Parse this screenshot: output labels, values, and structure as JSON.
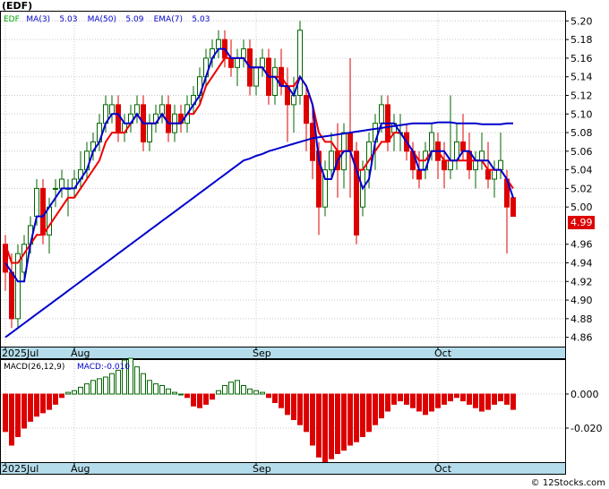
{
  "price_panel": {
    "symbol": "(EDF)",
    "legend": [
      {
        "label": "EDF",
        "color": "#00aa00"
      },
      {
        "label": "MA(3)",
        "color": "#0000cc"
      },
      {
        "label": "5.03",
        "color": "#0000cc"
      },
      {
        "label": "MA(50)",
        "color": "#0000cc"
      },
      {
        "label": "5.09",
        "color": "#0000cc"
      },
      {
        "label": "EMA(7)",
        "color": "#0000cc"
      },
      {
        "label": "5.03",
        "color": "#0000cc"
      }
    ],
    "last_price_label": "4.99"
  },
  "macd_panel": {
    "label": "MACD(26,12,9)",
    "value_label": "MACD:-0.010"
  },
  "watermark": "© 12Stocks.com",
  "colors": {
    "up": "#006600",
    "down": "#dd0000",
    "ma": "#0000cc",
    "ema": "#ee0000",
    "axis_band": "#b4dcea"
  },
  "chart_data": [
    {
      "type": "candlestick",
      "ylim": [
        4.85,
        5.21
      ],
      "yticks": [
        4.86,
        4.88,
        4.9,
        4.92,
        4.94,
        4.96,
        5.0,
        5.02,
        5.04,
        5.06,
        5.08,
        5.1,
        5.12,
        5.14,
        5.16,
        5.18,
        5.2
      ],
      "xtick_labels": [
        {
          "label": "2025Jul",
          "index": 0
        },
        {
          "label": "Aug",
          "index": 11
        },
        {
          "label": "Sep",
          "index": 40
        },
        {
          "label": "Oct",
          "index": 69
        }
      ],
      "candles": [
        [
          4.96,
          4.97,
          4.91,
          4.93
        ],
        [
          4.93,
          4.95,
          4.87,
          4.88
        ],
        [
          4.88,
          4.96,
          4.87,
          4.95
        ],
        [
          4.93,
          4.97,
          4.92,
          4.96
        ],
        [
          4.96,
          4.99,
          4.95,
          4.98
        ],
        [
          4.99,
          5.03,
          4.98,
          5.02
        ],
        [
          5.02,
          5.03,
          4.96,
          4.97
        ],
        [
          4.97,
          5.01,
          4.95,
          5.0
        ],
        [
          5.02,
          5.03,
          5.0,
          5.02
        ],
        [
          5.02,
          5.04,
          5.01,
          5.03
        ],
        [
          5.02,
          5.03,
          4.99,
          5.02
        ],
        [
          5.02,
          5.04,
          5.01,
          5.03
        ],
        [
          5.03,
          5.06,
          5.02,
          5.04
        ],
        [
          5.04,
          5.07,
          5.03,
          5.06
        ],
        [
          5.06,
          5.08,
          5.05,
          5.07
        ],
        [
          5.07,
          5.1,
          5.06,
          5.09
        ],
        [
          5.09,
          5.12,
          5.08,
          5.11
        ],
        [
          5.1,
          5.12,
          5.09,
          5.11
        ],
        [
          5.11,
          5.12,
          5.07,
          5.08
        ],
        [
          5.08,
          5.1,
          5.07,
          5.09
        ],
        [
          5.09,
          5.11,
          5.08,
          5.1
        ],
        [
          5.1,
          5.12,
          5.09,
          5.11
        ],
        [
          5.11,
          5.12,
          5.06,
          5.07
        ],
        [
          5.07,
          5.1,
          5.06,
          5.09
        ],
        [
          5.09,
          5.11,
          5.08,
          5.1
        ],
        [
          5.1,
          5.12,
          5.09,
          5.11
        ],
        [
          5.11,
          5.12,
          5.07,
          5.08
        ],
        [
          5.08,
          5.11,
          5.07,
          5.1
        ],
        [
          5.1,
          5.11,
          5.08,
          5.09
        ],
        [
          5.09,
          5.12,
          5.08,
          5.11
        ],
        [
          5.11,
          5.13,
          5.1,
          5.12
        ],
        [
          5.12,
          5.15,
          5.11,
          5.14
        ],
        [
          5.14,
          5.17,
          5.13,
          5.16
        ],
        [
          5.16,
          5.18,
          5.15,
          5.17
        ],
        [
          5.17,
          5.19,
          5.16,
          5.18
        ],
        [
          5.18,
          5.19,
          5.15,
          5.16
        ],
        [
          5.16,
          5.18,
          5.14,
          5.15
        ],
        [
          5.15,
          5.17,
          5.13,
          5.16
        ],
        [
          5.16,
          5.18,
          5.15,
          5.17
        ],
        [
          5.17,
          5.18,
          5.12,
          5.13
        ],
        [
          5.13,
          5.16,
          5.12,
          5.15
        ],
        [
          5.15,
          5.17,
          5.14,
          5.16
        ],
        [
          5.16,
          5.17,
          5.11,
          5.12
        ],
        [
          5.12,
          5.16,
          5.11,
          5.15
        ],
        [
          5.15,
          5.17,
          5.12,
          5.13
        ],
        [
          5.13,
          5.15,
          5.07,
          5.11
        ],
        [
          5.11,
          5.14,
          5.08,
          5.12
        ],
        [
          5.12,
          5.2,
          5.11,
          5.19
        ],
        [
          5.12,
          5.13,
          5.06,
          5.09
        ],
        [
          5.09,
          5.11,
          5.03,
          5.05
        ],
        [
          5.06,
          5.07,
          4.97,
          5.0
        ],
        [
          5.0,
          5.05,
          4.99,
          5.04
        ],
        [
          5.04,
          5.08,
          5.03,
          5.06
        ],
        [
          5.06,
          5.09,
          5.01,
          5.04
        ],
        [
          5.04,
          5.09,
          5.02,
          5.08
        ],
        [
          5.08,
          5.16,
          5.01,
          5.06
        ],
        [
          5.06,
          5.07,
          4.96,
          4.97
        ],
        [
          5.0,
          5.05,
          4.99,
          5.04
        ],
        [
          5.04,
          5.08,
          5.02,
          5.07
        ],
        [
          5.07,
          5.1,
          5.04,
          5.09
        ],
        [
          5.09,
          5.12,
          5.08,
          5.11
        ],
        [
          5.11,
          5.12,
          5.06,
          5.07
        ],
        [
          5.08,
          5.1,
          5.06,
          5.09
        ],
        [
          5.08,
          5.1,
          5.06,
          5.08
        ],
        [
          5.08,
          5.09,
          5.05,
          5.06
        ],
        [
          5.06,
          5.07,
          5.03,
          5.04
        ],
        [
          5.04,
          5.06,
          5.02,
          5.03
        ],
        [
          5.04,
          5.07,
          5.03,
          5.06
        ],
        [
          5.06,
          5.09,
          5.05,
          5.08
        ],
        [
          5.07,
          5.08,
          5.03,
          5.05
        ],
        [
          5.05,
          5.07,
          5.02,
          5.04
        ],
        [
          5.04,
          5.12,
          5.03,
          5.05
        ],
        [
          5.05,
          5.09,
          5.04,
          5.07
        ],
        [
          5.07,
          5.1,
          5.05,
          5.06
        ],
        [
          5.06,
          5.08,
          5.03,
          5.04
        ],
        [
          5.04,
          5.06,
          5.02,
          5.05
        ],
        [
          5.05,
          5.08,
          5.04,
          5.06
        ],
        [
          5.04,
          5.07,
          5.02,
          5.03
        ],
        [
          5.03,
          5.05,
          5.01,
          5.04
        ],
        [
          5.04,
          5.08,
          5.03,
          5.05
        ],
        [
          5.03,
          5.04,
          4.95,
          5.0
        ],
        [
          5.01,
          5.01,
          4.99,
          4.99
        ]
      ],
      "ma3": [
        4.94,
        4.93,
        4.92,
        4.92,
        4.96,
        4.99,
        4.99,
        5.0,
        5.01,
        5.02,
        5.02,
        5.02,
        5.03,
        5.04,
        5.06,
        5.07,
        5.09,
        5.1,
        5.1,
        5.09,
        5.09,
        5.1,
        5.09,
        5.09,
        5.09,
        5.1,
        5.09,
        5.09,
        5.09,
        5.1,
        5.11,
        5.12,
        5.14,
        5.16,
        5.17,
        5.17,
        5.16,
        5.16,
        5.16,
        5.15,
        5.15,
        5.15,
        5.14,
        5.14,
        5.13,
        5.13,
        5.12,
        5.14,
        5.13,
        5.11,
        5.05,
        5.03,
        5.03,
        5.05,
        5.06,
        5.06,
        5.04,
        5.02,
        5.03,
        5.07,
        5.09,
        5.09,
        5.09,
        5.08,
        5.07,
        5.06,
        5.04,
        5.04,
        5.06,
        5.06,
        5.06,
        5.05,
        5.05,
        5.06,
        5.06,
        5.05,
        5.05,
        5.05,
        5.04,
        5.04,
        5.03,
        5.01
      ],
      "ma50": [
        4.86,
        4.865,
        4.87,
        4.875,
        4.88,
        4.885,
        4.89,
        4.895,
        4.9,
        4.905,
        4.91,
        4.915,
        4.92,
        4.925,
        4.93,
        4.935,
        4.94,
        4.945,
        4.95,
        4.955,
        4.96,
        4.965,
        4.97,
        4.975,
        4.98,
        4.985,
        4.99,
        4.995,
        5.0,
        5.005,
        5.01,
        5.015,
        5.02,
        5.025,
        5.03,
        5.035,
        5.04,
        5.045,
        5.05,
        5.052,
        5.055,
        5.057,
        5.06,
        5.062,
        5.064,
        5.066,
        5.068,
        5.07,
        5.072,
        5.074,
        5.075,
        5.076,
        5.077,
        5.078,
        5.079,
        5.08,
        5.081,
        5.082,
        5.083,
        5.084,
        5.085,
        5.086,
        5.087,
        5.088,
        5.089,
        5.09,
        5.09,
        5.09,
        5.09,
        5.091,
        5.091,
        5.091,
        5.09,
        5.09,
        5.09,
        5.09,
        5.089,
        5.089,
        5.089,
        5.089,
        5.09,
        5.09
      ],
      "ema7": [
        4.96,
        4.94,
        4.94,
        4.95,
        4.96,
        4.97,
        4.97,
        4.98,
        4.99,
        5.0,
        5.01,
        5.01,
        5.02,
        5.03,
        5.04,
        5.05,
        5.07,
        5.08,
        5.08,
        5.08,
        5.09,
        5.1,
        5.09,
        5.09,
        5.09,
        5.1,
        5.09,
        5.09,
        5.09,
        5.1,
        5.1,
        5.11,
        5.13,
        5.14,
        5.15,
        5.16,
        5.16,
        5.16,
        5.16,
        5.15,
        5.15,
        5.15,
        5.14,
        5.14,
        5.14,
        5.13,
        5.13,
        5.14,
        5.13,
        5.11,
        5.08,
        5.07,
        5.07,
        5.06,
        5.06,
        5.06,
        5.04,
        5.04,
        5.05,
        5.06,
        5.07,
        5.07,
        5.08,
        5.08,
        5.07,
        5.06,
        5.05,
        5.05,
        5.06,
        5.06,
        5.05,
        5.05,
        5.05,
        5.05,
        5.05,
        5.05,
        5.05,
        5.04,
        5.04,
        5.04,
        5.03,
        5.02
      ]
    },
    {
      "type": "bar",
      "title": "MACD(26,12,9)",
      "ylim": [
        -0.04,
        0.02
      ],
      "yticks": [
        0.0,
        -0.02
      ],
      "ytick_labels": [
        "0.000",
        "-0.020"
      ],
      "xtick_labels": [
        {
          "label": "2025Jul",
          "index": 0
        },
        {
          "label": "Aug",
          "index": 11
        },
        {
          "label": "Sep",
          "index": 40
        },
        {
          "label": "Oct",
          "index": 69
        }
      ],
      "values": [
        -0.022,
        -0.03,
        -0.025,
        -0.02,
        -0.016,
        -0.013,
        -0.011,
        -0.009,
        -0.006,
        -0.002,
        0.001,
        0.002,
        0.004,
        0.006,
        0.008,
        0.009,
        0.01,
        0.012,
        0.014,
        0.02,
        0.021,
        0.016,
        0.012,
        0.008,
        0.006,
        0.005,
        0.003,
        0.001,
        0.0,
        -0.002,
        -0.007,
        -0.008,
        -0.006,
        -0.003,
        0.002,
        0.005,
        0.007,
        0.008,
        0.005,
        0.003,
        0.002,
        0.001,
        -0.002,
        -0.005,
        -0.008,
        -0.012,
        -0.015,
        -0.018,
        -0.022,
        -0.03,
        -0.037,
        -0.04,
        -0.038,
        -0.035,
        -0.033,
        -0.03,
        -0.028,
        -0.025,
        -0.022,
        -0.018,
        -0.014,
        -0.01,
        -0.006,
        -0.004,
        -0.006,
        -0.008,
        -0.01,
        -0.012,
        -0.01,
        -0.008,
        -0.006,
        -0.004,
        -0.002,
        -0.004,
        -0.006,
        -0.008,
        -0.01,
        -0.009,
        -0.006,
        -0.004,
        -0.006,
        -0.009
      ]
    }
  ]
}
